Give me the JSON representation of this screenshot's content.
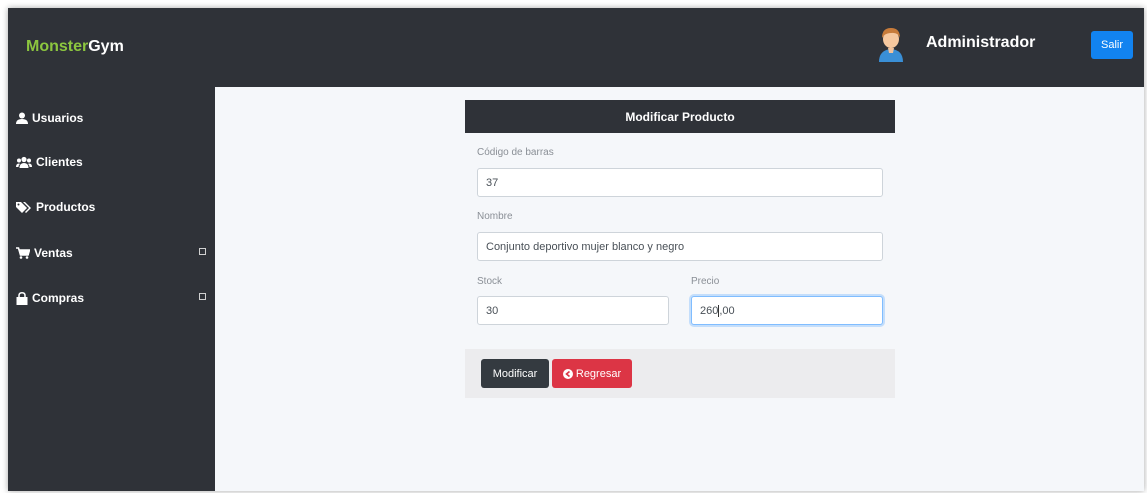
{
  "header": {
    "brand_part1": "Monster",
    "brand_part2": "Gym",
    "user_name": "Administrador",
    "logout_label": "Salir"
  },
  "sidebar": {
    "items": [
      {
        "label": "Usuarios",
        "icon": "user-icon"
      },
      {
        "label": "Clientes",
        "icon": "users-icon"
      },
      {
        "label": "Productos",
        "icon": "tags-icon"
      },
      {
        "label": "Ventas",
        "icon": "cart-icon",
        "expandable": true
      },
      {
        "label": "Compras",
        "icon": "shopping-bag-icon",
        "expandable": true
      }
    ]
  },
  "form": {
    "title": "Modificar Producto",
    "barcode_label": "Código de barras",
    "barcode_value": "37",
    "name_label": "Nombre",
    "name_value": "Conjunto deportivo mujer blanco y negro",
    "stock_label": "Stock",
    "stock_value": "30",
    "price_label": "Precio",
    "price_value_before_cursor": "260",
    "price_value_after_cursor": ",00",
    "modify_label": "Modificar",
    "back_label": "Regresar"
  },
  "colors": {
    "dark": "#2f3238",
    "brand_green": "#8cc63f",
    "primary": "#1283f0",
    "danger": "#dc3545"
  }
}
